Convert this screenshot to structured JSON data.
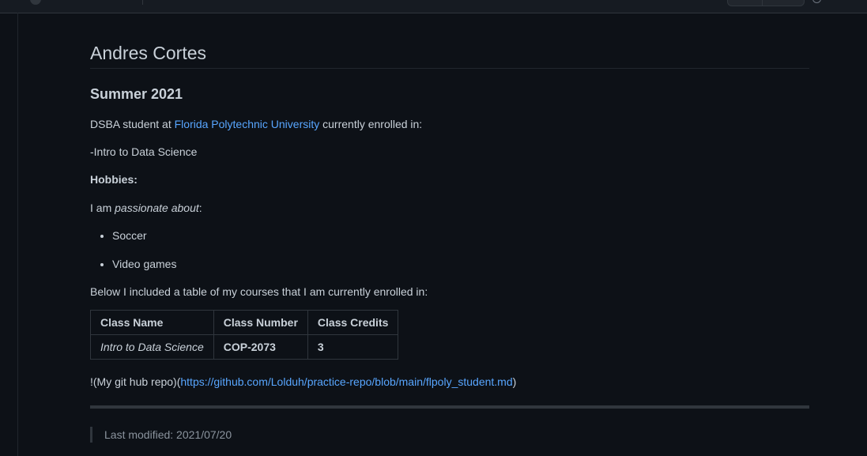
{
  "heading": "Andres Cortes",
  "subheading": "Summer 2021",
  "intro": {
    "prefix": "DSBA student at ",
    "link_text": "Florida Polytechnic University",
    "suffix": " currently enrolled in:"
  },
  "course_line": "-Intro to Data Science",
  "hobbies_label": "Hobbies:",
  "passion": {
    "prefix": "I am ",
    "emphasis": "passionate about",
    "suffix": ":"
  },
  "hobbies": [
    "Soccer",
    "Video games"
  ],
  "table_intro": "Below I included a table of my courses that I am currently enrolled in:",
  "table": {
    "headers": [
      "Class Name",
      "Class Number",
      "Class Credits"
    ],
    "rows": [
      [
        "Intro to Data Science",
        "COP-2073",
        "3"
      ]
    ]
  },
  "repo_line": {
    "prefix": "!(My git hub repo)(",
    "link_text": "https://github.com/Lolduh/practice-repo/blob/main/flpoly_student.md",
    "suffix": ")"
  },
  "footer_quote": "Last modified: 2021/07/20",
  "colors": {
    "background": "#0d1117",
    "text": "#c9d1d9",
    "link": "#58a6ff",
    "muted": "#8b949e",
    "border": "#30363d"
  }
}
